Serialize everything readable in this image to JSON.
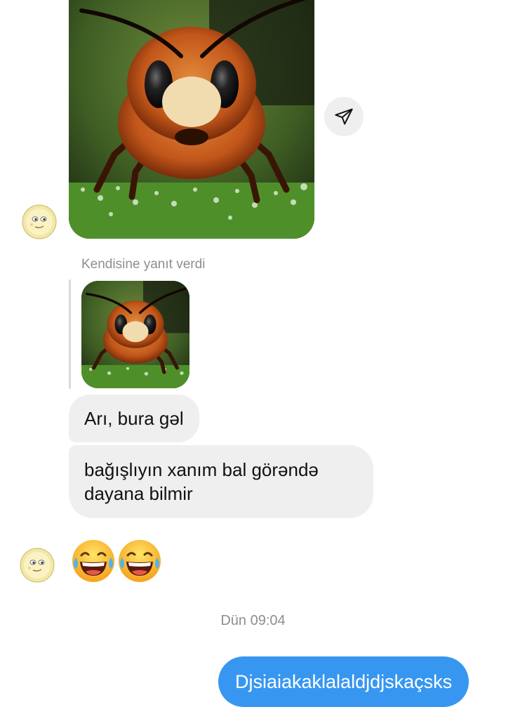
{
  "thread": {
    "reply_label": "Kendisine yanıt verdi",
    "messages": [
      {
        "text": "Arı, bura gəl"
      },
      {
        "text": "bağışlıyın xanım bal görəndə dayana bilmir"
      }
    ],
    "emoji_message": [
      "laughing-tears-emoji",
      "laughing-tears-emoji"
    ],
    "timestamp": "Dün 09:04",
    "sent_message": "Djsiaiakaklalaldjdjskaçsks"
  },
  "icons": {
    "share": "paper-plane-icon"
  },
  "colors": {
    "incoming_bubble": "#efefef",
    "outgoing_bubble": "#3797f0",
    "meta_text": "#8e8e8e"
  }
}
